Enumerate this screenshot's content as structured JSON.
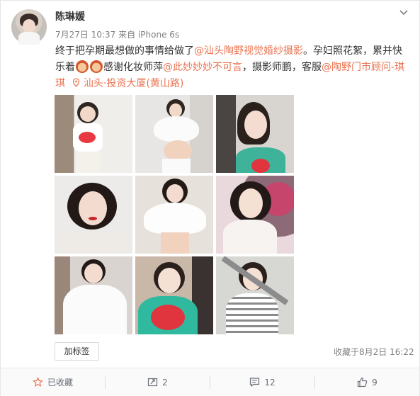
{
  "post": {
    "author": "陈琳媛",
    "timestamp": "7月27日 10:37",
    "source": "来自 iPhone 6s",
    "text_1": "终于把孕期最想做的事情给做了",
    "mention_studio": "@汕头陶野视觉婚纱摄影",
    "text_2": "。孕妇照花絮，累并快乐着",
    "text_3": "感谢化妆师萍",
    "mention_makeup": "@此妙妙妙不可言",
    "text_4": "，摄影师鹏，客服",
    "mention_service": "@陶野门市顾问-琪琪",
    "location": "汕头·投资大厦(黄山路)"
  },
  "actions": {
    "tag_button": "加标签",
    "favorite_time": "收藏于8月2日 16:22"
  },
  "footer": {
    "favorite": "已收藏",
    "repost": "2",
    "comment": "12",
    "like": "9"
  },
  "colors": {
    "link": "#eb7350",
    "meta": "#808080",
    "footer_text": "#696e78"
  },
  "icons": [
    "chevron-down-icon",
    "location-pin-icon",
    "star-icon",
    "repost-icon",
    "comment-icon",
    "thumbs-up-icon"
  ]
}
